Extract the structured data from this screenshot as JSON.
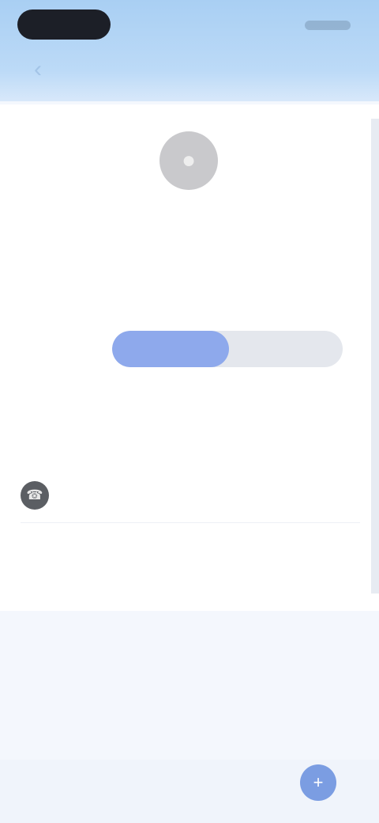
{
  "status_bar": {},
  "header": {
    "back_icon": "chevron-left-icon",
    "title": ""
  },
  "profile": {
    "avatar_icon": "user-icon",
    "name_label": "",
    "name_value": "",
    "status_label": "",
    "status_value": "",
    "role_label": "",
    "toggle": {
      "options": [
        "",
        ""
      ],
      "selected_index": 0
    },
    "hint": ""
  },
  "contact": {
    "section_label": "",
    "section_value": "",
    "phone_icon": "phone-icon",
    "phone_text": "",
    "phone_link": "",
    "add_link": ""
  },
  "details": {
    "info_line": "",
    "field_label": "",
    "field_value": "",
    "note_line": ""
  },
  "bottom": {
    "text": "",
    "fab_icon": "plus-icon"
  },
  "colors": {
    "header": "#a9cff3",
    "accent": "#8ea9ec",
    "fab": "#7b9de2",
    "background": "#f4f7fd"
  }
}
